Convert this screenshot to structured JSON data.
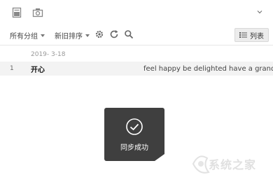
{
  "toolbar": {
    "icons": [
      "note-icon",
      "camera-icon",
      "chevron-down-icon"
    ]
  },
  "filter": {
    "group_label": "所有分组",
    "sort_label": "新旧排序",
    "tools": [
      "gear-icon",
      "refresh-icon",
      "search-icon"
    ],
    "view_label": "列表"
  },
  "notes": {
    "date": "2019- 3-18",
    "rows": [
      {
        "index": "1",
        "title": "开心",
        "preview": "feel happy be delighted have a grand..."
      }
    ]
  },
  "toast": {
    "message": "同步成功"
  },
  "watermark": {
    "text": "系统之家"
  }
}
